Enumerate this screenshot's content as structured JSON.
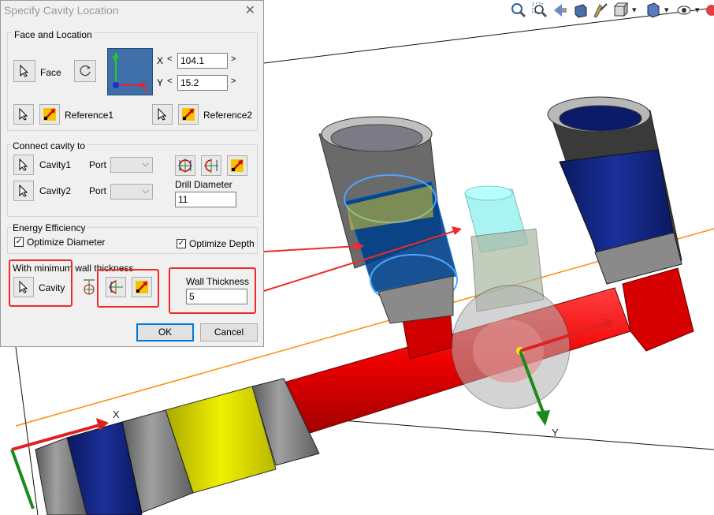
{
  "dialog": {
    "title": "Specify Cavity Location",
    "face_location": {
      "group_label": "Face and Location",
      "face_label": "Face",
      "x_label": "X",
      "x_value": "104.1",
      "y_label": "Y",
      "y_value": "15.2",
      "reference1_label": "Reference1",
      "reference2_label": "Reference2"
    },
    "connect": {
      "group_label": "Connect cavity to",
      "cavity1_label": "Cavity1",
      "cavity2_label": "Cavity2",
      "port_label": "Port",
      "port2_label": "Port",
      "drill_label": "Drill Diameter",
      "drill_value": "11"
    },
    "energy": {
      "group_label": "Energy Efficiency",
      "optimize_diameter_label": "Optimize Diameter",
      "optimize_depth_label": "Optimize Depth"
    },
    "wall": {
      "group_label": "With minimum wall thickness",
      "cavity_label": "Cavity",
      "wall_thickness_label": "Wall Thickness",
      "wall_thickness_value": "5"
    },
    "ok_label": "OK",
    "cancel_label": "Cancel"
  },
  "viewport": {
    "axis_x_label": "X",
    "axis_y_label": "Y"
  },
  "toolbar_icons": [
    "zoom-fit-icon",
    "zoom-area-icon",
    "previous-view-icon",
    "section-view-icon",
    "dynamic-annotation-icon",
    "view-orientation-icon",
    "display-style-icon",
    "hide-show-icon",
    "appearance-icon"
  ]
}
